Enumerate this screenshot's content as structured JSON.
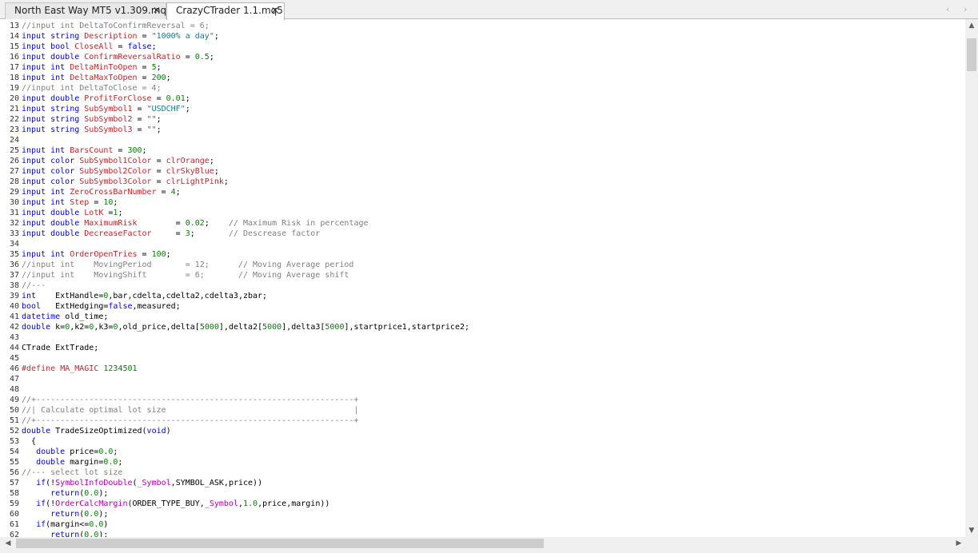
{
  "tabs": [
    {
      "label": "North East Way MT5 v1.309.mq5",
      "close": "✕",
      "active": false
    },
    {
      "label": "CrazyCTrader 1.1.mq5",
      "close": "✕",
      "active": true
    }
  ],
  "tab_nav": {
    "prev": "‹",
    "next": "›"
  },
  "scrollbar_glyphs": {
    "up": "▲",
    "down": "▼",
    "left": "◀",
    "right": "▶"
  },
  "code_lines": [
    {
      "n": "13",
      "parts": [
        [
          "cm",
          "//input int DeltaToConfirmReversal = 6;"
        ]
      ]
    },
    {
      "n": "14",
      "parts": [
        [
          "kw",
          "input string "
        ],
        [
          "id",
          "Description"
        ],
        [
          "",
          " = "
        ],
        [
          "str",
          "\"1000% a day\""
        ],
        [
          "",
          ";"
        ]
      ]
    },
    {
      "n": "15",
      "parts": [
        [
          "kw",
          "input bool "
        ],
        [
          "id",
          "CloseAll"
        ],
        [
          "",
          " = "
        ],
        [
          "kw",
          "false"
        ],
        [
          "",
          ";"
        ]
      ]
    },
    {
      "n": "16",
      "parts": [
        [
          "kw",
          "input double "
        ],
        [
          "id",
          "ConfirmReversalRatio"
        ],
        [
          "",
          " = "
        ],
        [
          "num",
          "0.5"
        ],
        [
          "",
          ";"
        ]
      ]
    },
    {
      "n": "17",
      "parts": [
        [
          "kw",
          "input int "
        ],
        [
          "id",
          "DeltaMinToOpen"
        ],
        [
          "",
          " = "
        ],
        [
          "num",
          "5"
        ],
        [
          "",
          ";"
        ]
      ]
    },
    {
      "n": "18",
      "parts": [
        [
          "kw",
          "input int "
        ],
        [
          "id",
          "DeltaMaxToOpen"
        ],
        [
          "",
          " = "
        ],
        [
          "num",
          "200"
        ],
        [
          "",
          ";"
        ]
      ]
    },
    {
      "n": "19",
      "parts": [
        [
          "cm",
          "//input int DeltaToClose = 4;"
        ]
      ]
    },
    {
      "n": "20",
      "parts": [
        [
          "kw",
          "input double "
        ],
        [
          "id",
          "ProfitForClose"
        ],
        [
          "",
          " = "
        ],
        [
          "num",
          "0.01"
        ],
        [
          "",
          ";"
        ]
      ]
    },
    {
      "n": "21",
      "parts": [
        [
          "kw",
          "input string "
        ],
        [
          "id",
          "SubSymbol1"
        ],
        [
          "",
          " = "
        ],
        [
          "str",
          "\"USDCHF\""
        ],
        [
          "",
          ";"
        ]
      ]
    },
    {
      "n": "22",
      "parts": [
        [
          "kw",
          "input string "
        ],
        [
          "id",
          "SubSymbol2"
        ],
        [
          "",
          " = "
        ],
        [
          "str",
          "\"\""
        ],
        [
          "",
          ";"
        ]
      ]
    },
    {
      "n": "23",
      "parts": [
        [
          "kw",
          "input string "
        ],
        [
          "id",
          "SubSymbol3"
        ],
        [
          "",
          " = "
        ],
        [
          "str",
          "\"\""
        ],
        [
          "",
          ";"
        ]
      ]
    },
    {
      "n": "24",
      "parts": []
    },
    {
      "n": "25",
      "parts": [
        [
          "kw",
          "input int "
        ],
        [
          "id",
          "BarsCount"
        ],
        [
          "",
          " = "
        ],
        [
          "num",
          "300"
        ],
        [
          "",
          ";"
        ]
      ]
    },
    {
      "n": "26",
      "parts": [
        [
          "kw",
          "input color "
        ],
        [
          "id",
          "SubSymbol1Color"
        ],
        [
          "",
          " = "
        ],
        [
          "id",
          "clrOrange"
        ],
        [
          "",
          ";"
        ]
      ]
    },
    {
      "n": "27",
      "parts": [
        [
          "kw",
          "input color "
        ],
        [
          "id",
          "SubSymbol2Color"
        ],
        [
          "",
          " = "
        ],
        [
          "id",
          "clrSkyBlue"
        ],
        [
          "",
          ";"
        ]
      ]
    },
    {
      "n": "28",
      "parts": [
        [
          "kw",
          "input color "
        ],
        [
          "id",
          "SubSymbol3Color"
        ],
        [
          "",
          " = "
        ],
        [
          "id",
          "clrLightPink"
        ],
        [
          "",
          ";"
        ]
      ]
    },
    {
      "n": "29",
      "parts": [
        [
          "kw",
          "input int "
        ],
        [
          "id",
          "ZeroCrossBarNumber"
        ],
        [
          "",
          " = "
        ],
        [
          "num",
          "4"
        ],
        [
          "",
          ";"
        ]
      ]
    },
    {
      "n": "30",
      "parts": [
        [
          "kw",
          "input int "
        ],
        [
          "id",
          "Step"
        ],
        [
          "",
          " = "
        ],
        [
          "num",
          "10"
        ],
        [
          "",
          ";"
        ]
      ]
    },
    {
      "n": "31",
      "parts": [
        [
          "kw",
          "input double "
        ],
        [
          "id",
          "LotK"
        ],
        [
          "",
          " ="
        ],
        [
          "num",
          "1"
        ],
        [
          "",
          ";"
        ]
      ]
    },
    {
      "n": "32",
      "parts": [
        [
          "kw",
          "input double "
        ],
        [
          "id",
          "MaximumRisk"
        ],
        [
          "",
          "        = "
        ],
        [
          "num",
          "0.02"
        ],
        [
          "",
          ";    "
        ],
        [
          "cm",
          "// Maximum Risk in percentage"
        ]
      ]
    },
    {
      "n": "33",
      "parts": [
        [
          "kw",
          "input double "
        ],
        [
          "id",
          "DecreaseFactor"
        ],
        [
          "",
          "     = "
        ],
        [
          "num",
          "3"
        ],
        [
          "",
          ";       "
        ],
        [
          "cm",
          "// Descrease factor"
        ]
      ]
    },
    {
      "n": "34",
      "parts": []
    },
    {
      "n": "35",
      "parts": [
        [
          "kw",
          "input int "
        ],
        [
          "id",
          "OrderOpenTries"
        ],
        [
          "",
          " = "
        ],
        [
          "num",
          "100"
        ],
        [
          "",
          ";"
        ]
      ]
    },
    {
      "n": "36",
      "parts": [
        [
          "cm",
          "//input int    MovingPeriod       = 12;      // Moving Average period"
        ]
      ]
    },
    {
      "n": "37",
      "parts": [
        [
          "cm",
          "//input int    MovingShift        = 6;       // Moving Average shift"
        ]
      ]
    },
    {
      "n": "38",
      "parts": [
        [
          "cm",
          "//---"
        ]
      ]
    },
    {
      "n": "39",
      "parts": [
        [
          "kw",
          "int"
        ],
        [
          "",
          "    ExtHandle="
        ],
        [
          "num",
          "0"
        ],
        [
          "",
          ",bar,cdelta,cdelta2,cdelta3,zbar;"
        ]
      ]
    },
    {
      "n": "40",
      "parts": [
        [
          "kw",
          "bool"
        ],
        [
          "",
          "   ExtHedging="
        ],
        [
          "kw",
          "false"
        ],
        [
          "",
          ",measured;"
        ]
      ]
    },
    {
      "n": "41",
      "parts": [
        [
          "kw",
          "datetime"
        ],
        [
          "",
          " old_time;"
        ]
      ]
    },
    {
      "n": "42",
      "parts": [
        [
          "kw",
          "double"
        ],
        [
          "",
          " k="
        ],
        [
          "num",
          "0"
        ],
        [
          "",
          ",k2="
        ],
        [
          "num",
          "0"
        ],
        [
          "",
          ",k3="
        ],
        [
          "num",
          "0"
        ],
        [
          "",
          ",old_price,delta["
        ],
        [
          "num",
          "5000"
        ],
        [
          "",
          "],delta2["
        ],
        [
          "num",
          "5000"
        ],
        [
          "",
          "],delta3["
        ],
        [
          "num",
          "5000"
        ],
        [
          "",
          "],startprice1,startprice2;"
        ]
      ]
    },
    {
      "n": "43",
      "parts": []
    },
    {
      "n": "44",
      "parts": [
        [
          "",
          "CTrade ExtTrade;"
        ]
      ]
    },
    {
      "n": "45",
      "parts": []
    },
    {
      "n": "46",
      "parts": [
        [
          "pp",
          "#define"
        ],
        [
          "",
          " "
        ],
        [
          "id",
          "MA_MAGIC"
        ],
        [
          "",
          " "
        ],
        [
          "num",
          "1234501"
        ]
      ]
    },
    {
      "n": "47",
      "parts": []
    },
    {
      "n": "48",
      "parts": []
    },
    {
      "n": "49",
      "parts": [
        [
          "cm",
          "//+------------------------------------------------------------------+"
        ]
      ]
    },
    {
      "n": "50",
      "parts": [
        [
          "cm",
          "//| Calculate optimal lot size                                       |"
        ]
      ]
    },
    {
      "n": "51",
      "parts": [
        [
          "cm",
          "//+------------------------------------------------------------------+"
        ]
      ]
    },
    {
      "n": "52",
      "parts": [
        [
          "kw",
          "double"
        ],
        [
          "",
          " TradeSizeOptimized("
        ],
        [
          "kw",
          "void"
        ],
        [
          "",
          ")"
        ]
      ]
    },
    {
      "n": "53",
      "parts": [
        [
          "",
          "  {"
        ]
      ]
    },
    {
      "n": "54",
      "parts": [
        [
          "",
          "   "
        ],
        [
          "kw",
          "double"
        ],
        [
          "",
          " price="
        ],
        [
          "num",
          "0.0"
        ],
        [
          "",
          ";"
        ]
      ]
    },
    {
      "n": "55",
      "parts": [
        [
          "",
          "   "
        ],
        [
          "kw",
          "double"
        ],
        [
          "",
          " margin="
        ],
        [
          "num",
          "0.0"
        ],
        [
          "",
          ";"
        ]
      ]
    },
    {
      "n": "56",
      "parts": [
        [
          "cm",
          "//--- select lot size"
        ]
      ]
    },
    {
      "n": "57",
      "parts": [
        [
          "",
          "   "
        ],
        [
          "kw",
          "if"
        ],
        [
          "",
          "(!"
        ],
        [
          "mag",
          "SymbolInfoDouble"
        ],
        [
          "",
          "("
        ],
        [
          "mag",
          "_Symbol"
        ],
        [
          "",
          ","
        ],
        [
          "",
          "SYMBOL_ASK"
        ],
        [
          "",
          ",price))"
        ]
      ]
    },
    {
      "n": "58",
      "parts": [
        [
          "",
          "      "
        ],
        [
          "kw",
          "return"
        ],
        [
          "",
          "("
        ],
        [
          "num",
          "0.0"
        ],
        [
          "",
          ");"
        ]
      ]
    },
    {
      "n": "59",
      "parts": [
        [
          "",
          "   "
        ],
        [
          "kw",
          "if"
        ],
        [
          "",
          "(!"
        ],
        [
          "mag",
          "OrderCalcMargin"
        ],
        [
          "",
          "("
        ],
        [
          "",
          "ORDER_TYPE_BUY"
        ],
        [
          "",
          ","
        ],
        [
          "mag",
          "_Symbol"
        ],
        [
          "",
          ","
        ],
        [
          "num",
          "1.0"
        ],
        [
          "",
          ",price,margin))"
        ]
      ]
    },
    {
      "n": "60",
      "parts": [
        [
          "",
          "      "
        ],
        [
          "kw",
          "return"
        ],
        [
          "",
          "("
        ],
        [
          "num",
          "0.0"
        ],
        [
          "",
          ");"
        ]
      ]
    },
    {
      "n": "61",
      "parts": [
        [
          "",
          "   "
        ],
        [
          "kw",
          "if"
        ],
        [
          "",
          "(margin<="
        ],
        [
          "num",
          "0.0"
        ],
        [
          "",
          ")"
        ]
      ]
    },
    {
      "n": "62",
      "parts": [
        [
          "",
          "      "
        ],
        [
          "kw",
          "return"
        ],
        [
          "",
          "("
        ],
        [
          "num",
          "0.0"
        ],
        [
          "",
          ");"
        ]
      ]
    }
  ]
}
